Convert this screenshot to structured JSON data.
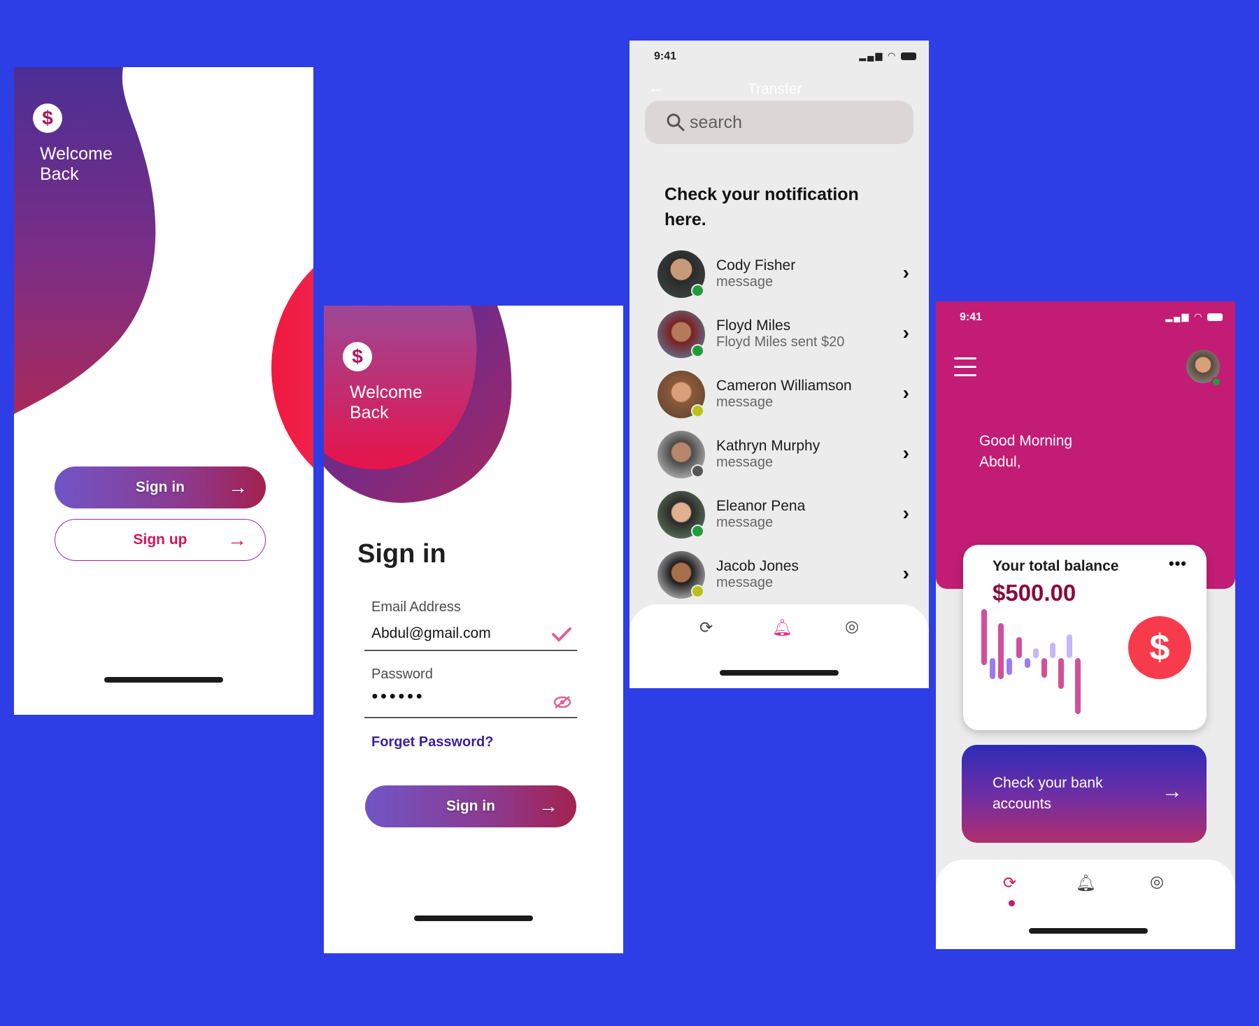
{
  "screen1": {
    "welcome": "Welcome Back",
    "logo_symbol": "$",
    "signin_label": "Sign in",
    "signup_label": "Sign up",
    "arrow": "→"
  },
  "screen2": {
    "welcome": "Welcome Back",
    "logo_symbol": "$",
    "title": "Sign in",
    "email_label": "Email Address",
    "email_value": "Abdul@gmail.com",
    "password_label": "Password",
    "password_value": "●●●●●●",
    "forgot": "Forget Password?",
    "signin_label": "Sign in",
    "arrow": "→"
  },
  "screen3": {
    "time": "9:41",
    "header_title": "Transfer",
    "search_placeholder": "search",
    "notif_title": "Check your notification here.",
    "rows": [
      {
        "name": "Cody Fisher",
        "message": "message"
      },
      {
        "name": "Floyd Miles",
        "message": "Floyd Miles sent $20"
      },
      {
        "name": "Cameron Williamson",
        "message": "message"
      },
      {
        "name": "Kathryn Murphy",
        "message": "message"
      },
      {
        "name": "Eleanor Pena",
        "message": "message"
      },
      {
        "name": "Jacob Jones",
        "message": "message"
      }
    ],
    "colors": {
      "online": "#1e9e3a",
      "away": "#b8c214",
      "offline": "#555555",
      "accent": "#e0368c"
    }
  },
  "screen4": {
    "time": "9:41",
    "greeting": "Good Morning Abdul,",
    "balance_label": "Your total balance",
    "balance_value": "$500.00",
    "more": "•••",
    "coin_symbol": "$",
    "bank_text": "Check your bank accounts",
    "arrow": "→",
    "colors": {
      "brand": "#c21c75",
      "coin": "#f73b4c",
      "bar_pink": "#d24f9c",
      "bar_purple": "#9b7cf0",
      "bar_lilac": "#c7b6f8"
    }
  }
}
